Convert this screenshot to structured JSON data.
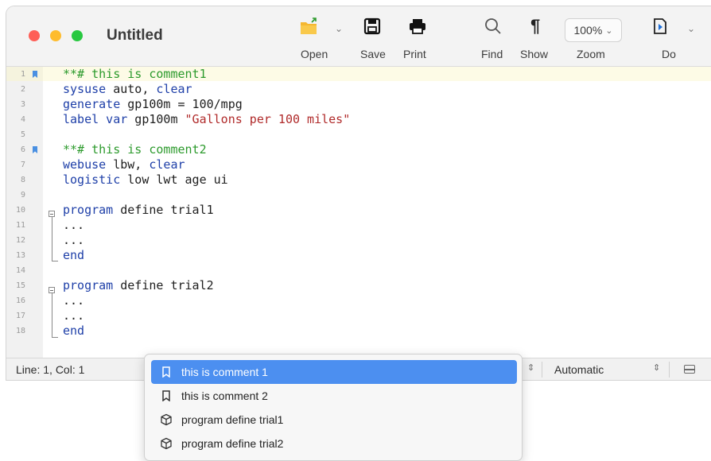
{
  "window": {
    "title": "Untitled"
  },
  "toolbar": {
    "open_label": "Open",
    "save_label": "Save",
    "print_label": "Print",
    "find_label": "Find",
    "show_label": "Show",
    "zoom_label": "Zoom",
    "zoom_value": "100%",
    "do_label": "Do"
  },
  "editor": {
    "line_numbers": [
      "1",
      "2",
      "3",
      "4",
      "5",
      "6",
      "7",
      "8",
      "9",
      "10",
      "11",
      "12",
      "13",
      "14",
      "15",
      "16",
      "17",
      "18"
    ],
    "lines": {
      "l1": "**# this is comment1",
      "l2_kw": "sysuse",
      "l2_rest": " auto, ",
      "l2_kw2": "clear",
      "l3_kw": "generate",
      "l3_rest": " gp100m = 100/mpg",
      "l4_kw": "label var",
      "l4_rest": " gp100m ",
      "l4_str": "\"Gallons per 100 miles\"",
      "l6": "**# this is comment2",
      "l7_kw": "webuse",
      "l7_rest": " lbw, ",
      "l7_kw2": "clear",
      "l8_kw": "logistic",
      "l8_rest": " low lwt age ui",
      "l10_kw": "program",
      "l10_rest": " define trial1",
      "l11": "...",
      "l12": "...",
      "l13": "end",
      "l15_kw": "program",
      "l15_rest": " define trial2",
      "l16": "...",
      "l17": "...",
      "l18": "end"
    }
  },
  "status": {
    "position": "Line: 1, Col: 1",
    "encoding": "Automatic"
  },
  "bookmark_menu": {
    "items": [
      {
        "label": "this is comment 1",
        "icon": "bookmark-icon"
      },
      {
        "label": "this is comment 2",
        "icon": "bookmark-icon"
      },
      {
        "label": "program define trial1",
        "icon": "cube-icon"
      },
      {
        "label": "program define trial2",
        "icon": "cube-icon"
      }
    ]
  },
  "colors": {
    "accent": "#4c8ff0",
    "comment": "#2c9a2c",
    "keyword": "#1e3fa8",
    "string": "#b02a2a",
    "bookmark": "#4a90e2"
  }
}
